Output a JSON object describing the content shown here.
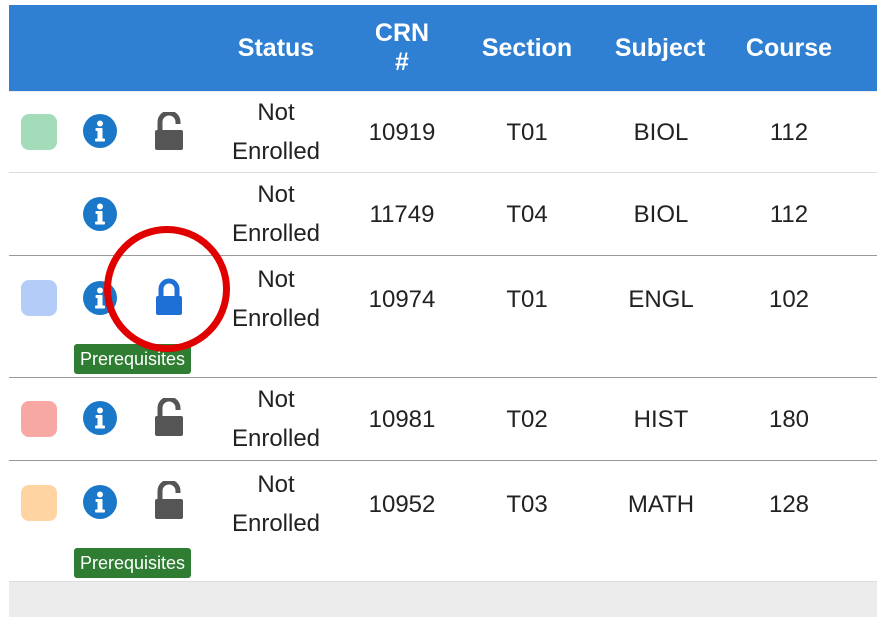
{
  "headers": {
    "status": "Status",
    "crn": "CRN\n#",
    "section": "Section",
    "subject": "Subject",
    "course": "Course"
  },
  "colors": {
    "header": "#2f7fd2",
    "badge": "#2e7d32",
    "info_icon": "#1b78c8",
    "lock_open": "#555555",
    "lock_closed": "#1e6fd6"
  },
  "rows": [
    {
      "status": "Not\nEnrolled",
      "crn": "10919",
      "section": "T01",
      "subject": "BIOL",
      "course": "112",
      "swatch": "#a4dcb9",
      "info_icon": "info-icon",
      "lock": "unlock-icon",
      "badge": ""
    },
    {
      "status": "Not\nEnrolled",
      "crn": "11749",
      "section": "T04",
      "subject": "BIOL",
      "course": "112",
      "swatch": "",
      "info_icon": "info-icon",
      "lock": "",
      "badge": ""
    },
    {
      "status": "Not\nEnrolled",
      "crn": "10974",
      "section": "T01",
      "subject": "ENGL",
      "course": "102",
      "swatch": "#b3cdf8",
      "info_icon": "info-icon",
      "lock": "lock-icon",
      "badge": "Prerequisites"
    },
    {
      "status": "Not\nEnrolled",
      "crn": "10981",
      "section": "T02",
      "subject": "HIST",
      "course": "180",
      "swatch": "#f7a8a4",
      "info_icon": "info-icon",
      "lock": "unlock-icon",
      "badge": ""
    },
    {
      "status": "Not\nEnrolled",
      "crn": "10952",
      "section": "T03",
      "subject": "MATH",
      "course": "128",
      "swatch": "#ffd4a3",
      "info_icon": "info-icon",
      "lock": "unlock-icon",
      "badge": "Prerequisites"
    }
  ]
}
